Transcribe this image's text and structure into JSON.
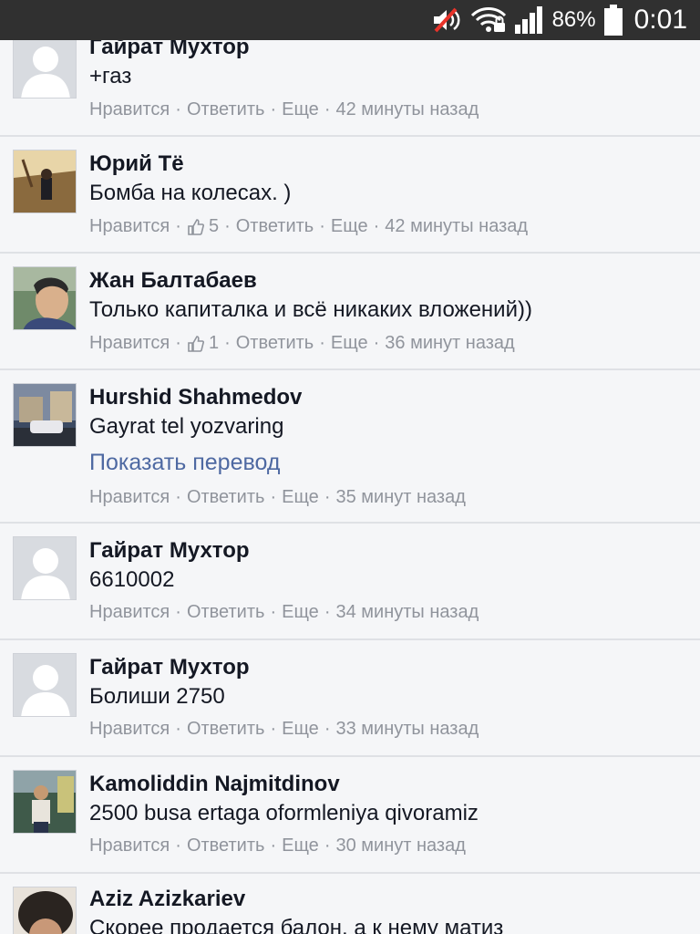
{
  "status_bar": {
    "battery_percent": "86%",
    "time": "0:01",
    "icons": [
      "muted-speaker-icon",
      "wifi-locked-icon",
      "signal-bars-icon",
      "battery-icon"
    ]
  },
  "meta_labels": {
    "like": "Нравится",
    "reply": "Ответить",
    "more": "Еще",
    "separator": "·"
  },
  "comments": [
    {
      "author": "Гайрат Мухтор",
      "text": "+газ",
      "time": "42 минуты назад",
      "likes": null,
      "avatar": "default-avatar"
    },
    {
      "author": "Юрий Тё",
      "text": "Бомба на колесах. )",
      "time": "42 минуты назад",
      "likes": "5",
      "avatar": "photo-avatar"
    },
    {
      "author": "Жан Балтабаев",
      "text": "Только капиталка и всё никаких вложений))",
      "time": "36 минут назад",
      "likes": "1",
      "avatar": "photo-avatar"
    },
    {
      "author": "Hurshid Shahmedov",
      "text": "Gayrat tel yozvaring",
      "translate": "Показать перевод",
      "time": "35 минут назад",
      "likes": null,
      "avatar": "photo-avatar"
    },
    {
      "author": "Гайрат Мухтор",
      "text": "6610002",
      "time": "34 минуты назад",
      "likes": null,
      "avatar": "default-avatar"
    },
    {
      "author": "Гайрат Мухтор",
      "text": "Болиши 2750",
      "time": "33 минуты назад",
      "likes": null,
      "avatar": "default-avatar"
    },
    {
      "author": "Kamoliddin Najmitdinov",
      "text": "2500 busa ertaga oformleniya qivoramiz",
      "time": "30 минут назад",
      "likes": null,
      "avatar": "photo-avatar"
    },
    {
      "author": "Aziz Azizkariev",
      "text": "Скорее продается балон, а к нему матиз",
      "time": "",
      "likes": null,
      "avatar": "photo-avatar"
    }
  ]
}
